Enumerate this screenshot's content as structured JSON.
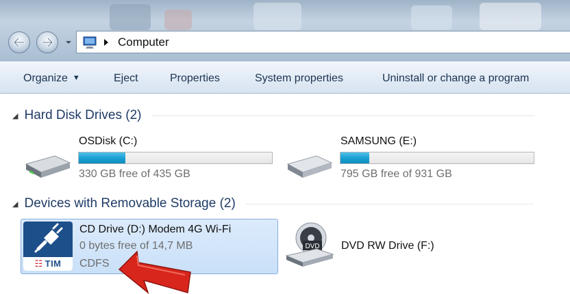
{
  "address_bar": {
    "path": "Computer",
    "icons": {
      "location": "computer-monitor-icon",
      "separator": "breadcrumb-arrow-icon"
    }
  },
  "navigation": {
    "back_icon": "back-arrow-icon",
    "forward_icon": "forward-arrow-icon",
    "recent_icon": "dropdown-arrow-icon"
  },
  "toolbar": {
    "organize": "Organize",
    "eject": "Eject",
    "properties": "Properties",
    "system_properties": "System properties",
    "uninstall": "Uninstall or change a program"
  },
  "groups": [
    {
      "title": "Hard Disk Drives (2)",
      "drives": [
        {
          "name": "OSDisk (C:)",
          "free_text": "330 GB free of 435 GB",
          "used_fraction": 0.24,
          "icon": "hard-drive-icon"
        },
        {
          "name": "SAMSUNG (E:)",
          "free_text": "795 GB free of 931 GB",
          "used_fraction": 0.15,
          "icon": "hard-drive-icon"
        }
      ]
    },
    {
      "title": "Devices with Removable Storage (2)",
      "drives": [
        {
          "name": "CD Drive (D:) Modem 4G Wi-Fi",
          "free_text": "0 bytes free of 14,7 MB",
          "filesystem": "CDFS",
          "icon": "tim-modem-icon",
          "logo_text": "TIM",
          "selected": true
        },
        {
          "name": "DVD RW Drive (F:)",
          "icon": "dvd-drive-icon",
          "icon_label": "DVD"
        }
      ]
    }
  ],
  "annotation": {
    "icon": "red-arrow-icon",
    "color": "#d8261c"
  },
  "colors": {
    "progress": "#1aa1d4",
    "header_text": "#1e3b66",
    "selection": "#cfe3f9",
    "tim_blue": "#1d4f8a"
  }
}
